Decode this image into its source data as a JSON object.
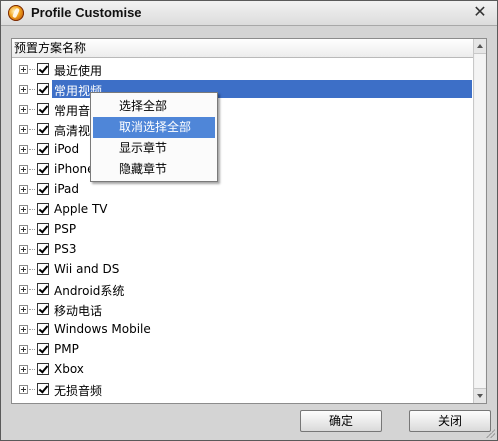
{
  "window": {
    "title": "Profile Customise",
    "close_glyph": "✕"
  },
  "tree": {
    "header": "预置方案名称",
    "items": [
      {
        "label": "最近使用",
        "checked": true
      },
      {
        "label": "常用视频",
        "checked": true,
        "selected": true
      },
      {
        "label": "常用音",
        "checked": true
      },
      {
        "label": "高清视",
        "checked": true
      },
      {
        "label": "iPod",
        "checked": true
      },
      {
        "label": "iPhone",
        "checked": true
      },
      {
        "label": "iPad",
        "checked": true
      },
      {
        "label": "Apple TV",
        "checked": true
      },
      {
        "label": "PSP",
        "checked": true
      },
      {
        "label": "PS3",
        "checked": true
      },
      {
        "label": "Wii and DS",
        "checked": true
      },
      {
        "label": "Android系统",
        "checked": true
      },
      {
        "label": "移动电话",
        "checked": true
      },
      {
        "label": "Windows Mobile",
        "checked": true
      },
      {
        "label": "PMP",
        "checked": true
      },
      {
        "label": "Xbox",
        "checked": true
      },
      {
        "label": "无损音频",
        "checked": true
      }
    ]
  },
  "context_menu": {
    "items": [
      {
        "label": "选择全部"
      },
      {
        "label": "取消选择全部",
        "highlighted": true
      },
      {
        "label": "显示章节"
      },
      {
        "label": "隐藏章节"
      }
    ]
  },
  "buttons": {
    "ok": "确定",
    "close": "关闭"
  },
  "colors": {
    "selection": "#3d6fc7",
    "menu_highlight": "#4f86d8"
  }
}
